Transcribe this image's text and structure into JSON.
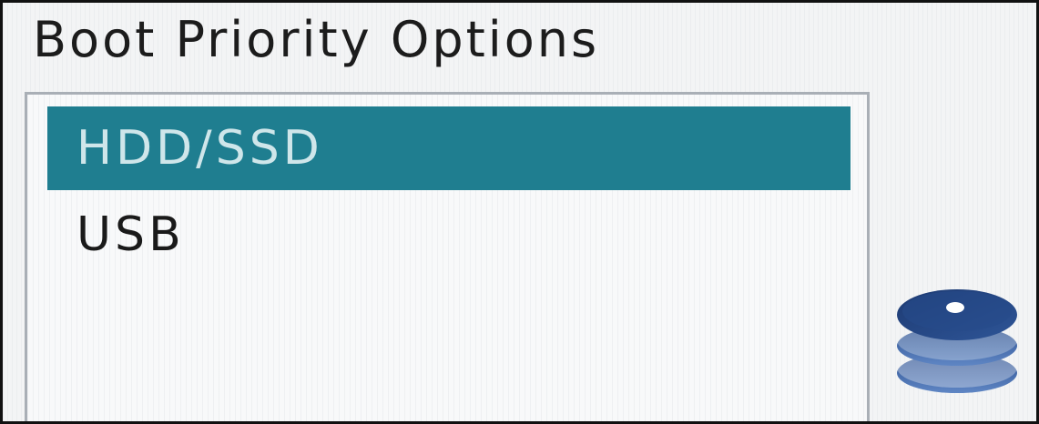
{
  "header": {
    "title": "Boot Priority Options"
  },
  "boot_list": {
    "items": [
      {
        "label": "HDD/SSD",
        "selected": true
      },
      {
        "label": "USB",
        "selected": false
      }
    ]
  },
  "icons": {
    "storage": "disk-stack-icon"
  },
  "colors": {
    "selection_highlight": "#1f7e90",
    "selected_text": "#cfe6ea",
    "text": "#1a1a1a",
    "list_border": "#a9afb6",
    "icon": "#1f3f7a"
  }
}
